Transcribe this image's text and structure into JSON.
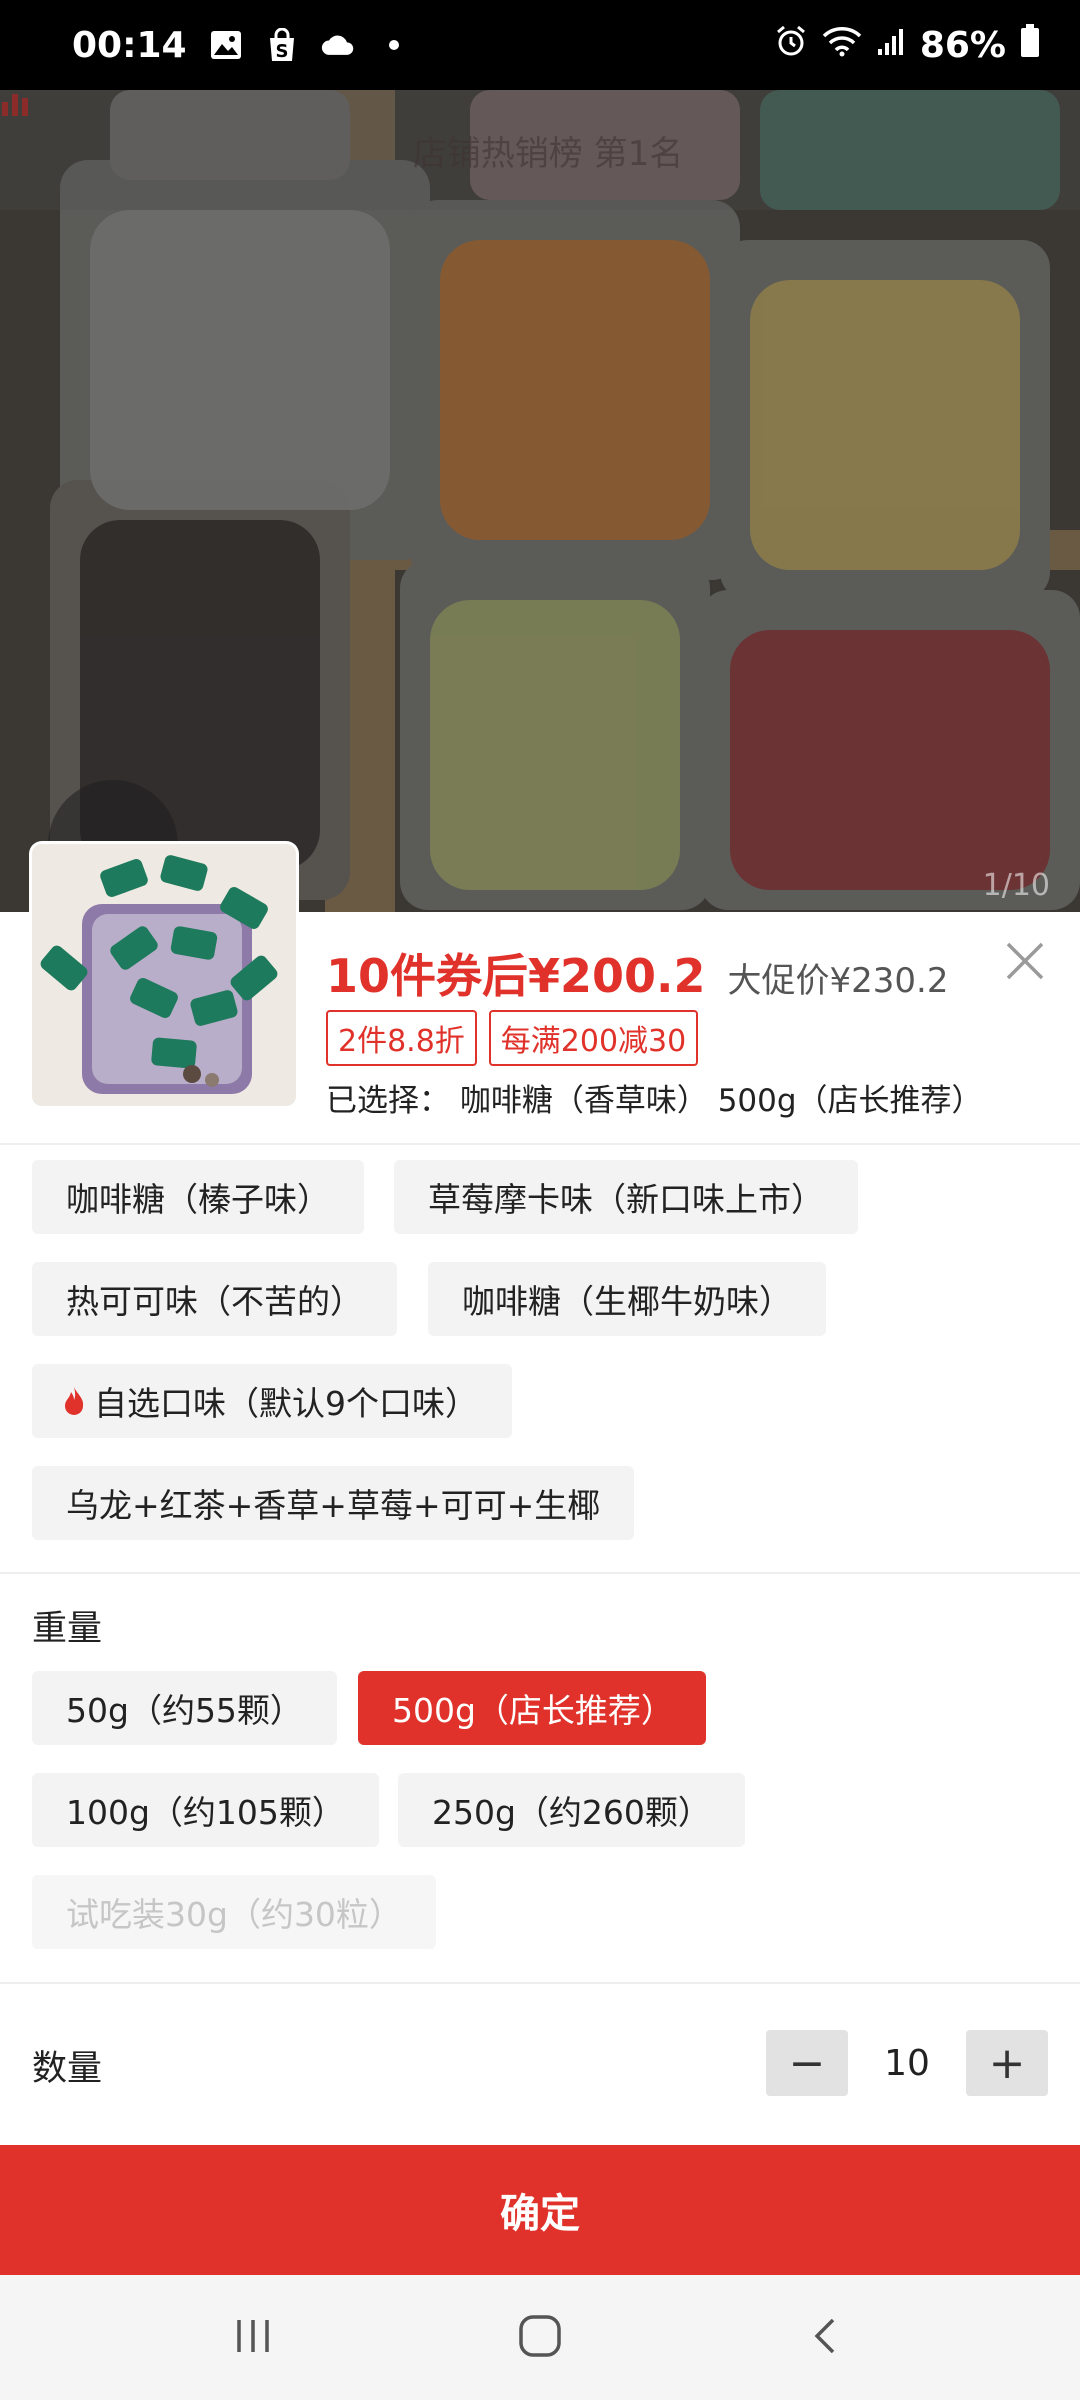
{
  "status_bar": {
    "time": "00:14",
    "battery": "86%",
    "icons": [
      "image-icon",
      "shop-icon",
      "cloud-icon",
      "dot-icon",
      "alarm-icon",
      "wifi-icon",
      "signal-icon",
      "battery-icon"
    ]
  },
  "photo": {
    "rank_banner": "店铺热销榜 第1名",
    "counter": "1/10"
  },
  "sheet": {
    "price_main": "10件券后¥200.2",
    "price_promo": "大促价¥230.2",
    "tags": [
      "2件8.8折",
      "每满200减30"
    ],
    "selected_text": "已选择：  咖啡糖（香草味）  500g（店长推荐）"
  },
  "flavors": {
    "options": [
      "咖啡糖（榛子味）",
      "草莓摩卡味（新口味上市）",
      "热可可味（不苦的）",
      "咖啡糖（生椰牛奶味）",
      "自选口味（默认9个口味）",
      "乌龙+红茶+香草+草莓+可可+生椰"
    ]
  },
  "weight": {
    "title": "重量",
    "options": [
      "50g（约55颗）",
      "500g（店长推荐）",
      "100g（约105颗）",
      "250g（约260颗）",
      "试吃装30g（约30粒）"
    ],
    "selected": "500g（店长推荐）"
  },
  "quantity": {
    "label": "数量",
    "value": "10",
    "minus": "−",
    "plus": "+"
  },
  "confirm_label": "确定",
  "colors": {
    "accent": "#e0322a",
    "chip_bg": "#f3f3f3"
  }
}
